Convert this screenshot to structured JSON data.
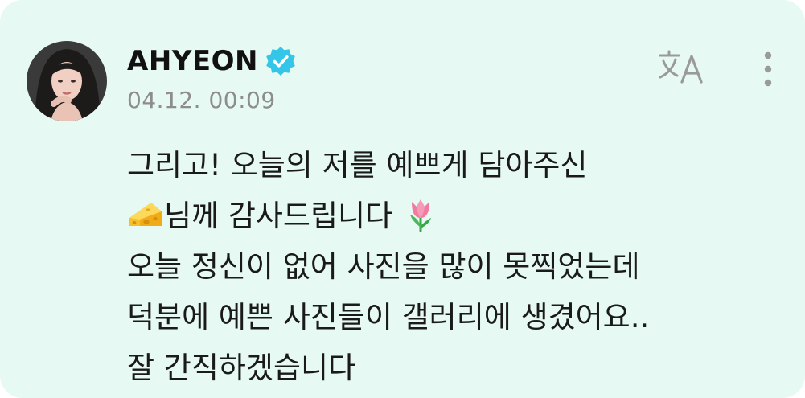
{
  "post": {
    "author": "AHYEON",
    "verified_icon": "verified-badge-icon",
    "timestamp": "04.12. 00:09",
    "translate_icon": "translate-icon",
    "more_icon": "more-vertical-icon",
    "avatar_icon": "profile-avatar",
    "message": {
      "line1": "그리고! 오늘의 저를 예쁘게 담아주신",
      "line2_emoji_before": "cheese-emoji",
      "line2": "님께 감사드립니다 ",
      "line2_emoji_after": "tulip-emoji",
      "line3": "오늘 정신이 없어 사진을 많이 못찍었는데",
      "line4": "덕분에 예쁜 사진들이 갤러리에 생겼어요..",
      "line5": "잘 간직하겠습니다"
    }
  },
  "colors": {
    "card_bg": "#e6f9f3",
    "verified": "#34c6e8",
    "text": "#1a1a1a",
    "timestamp": "#8d8d8d",
    "icons": "#9a9a9a"
  }
}
